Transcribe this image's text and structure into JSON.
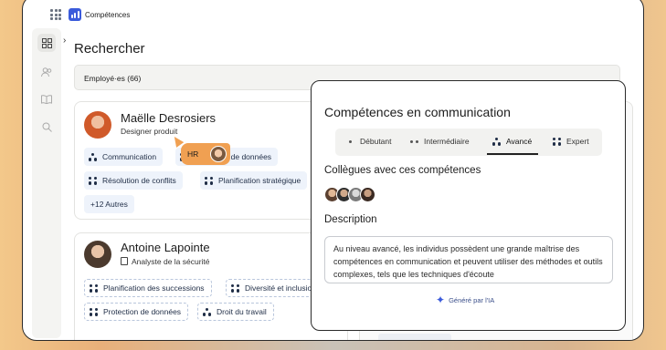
{
  "app": {
    "name": "Compétences"
  },
  "page": {
    "title": "Rechercher"
  },
  "tabs": [
    {
      "label": "Employé·es (66)"
    }
  ],
  "employees": [
    {
      "name": "Maëlle Desrosiers",
      "role": "Designer produit",
      "skills": [
        {
          "label": "Communication",
          "icon": "triangle-dots-icon"
        },
        {
          "label": "Protection de données",
          "icon": "four-dots-icon"
        },
        {
          "label": "Résolution de conflits",
          "icon": "four-dots-icon"
        },
        {
          "label": "Planification stratégique",
          "icon": "four-dots-icon"
        }
      ],
      "more": "+12 Autres"
    },
    {
      "name": "Antoine Lapointe",
      "role": "Analyste de la sécurité",
      "skills": [
        {
          "label": "Planification des successions",
          "icon": "four-dots-icon"
        },
        {
          "label": "Diversité et inclusion",
          "icon": "four-dots-icon"
        },
        {
          "label": "Protection de données",
          "icon": "four-dots-icon"
        },
        {
          "label": "Droit du travail",
          "icon": "triangle-dots-icon"
        }
      ]
    }
  ],
  "cursor_tag": {
    "label": "HR"
  },
  "popup": {
    "title": "Compétences en communication",
    "levels": [
      {
        "label": "Débutant",
        "icon": "one-dot-icon"
      },
      {
        "label": "Intermédiaire",
        "icon": "two-dots-icon"
      },
      {
        "label": "Avancé",
        "icon": "triangle-dots-icon",
        "active": true
      },
      {
        "label": "Expert",
        "icon": "four-dots-icon"
      }
    ],
    "colleagues_title": "Collègues avec ces compétences",
    "description_title": "Description",
    "description": "Au niveau avancé, les individus possèdent une grande maîtrise des compétences en communication et peuvent utiliser des méthodes et outils complexes, tels que les techniques d'écoute",
    "ai_note": "Généré par l'IA"
  }
}
